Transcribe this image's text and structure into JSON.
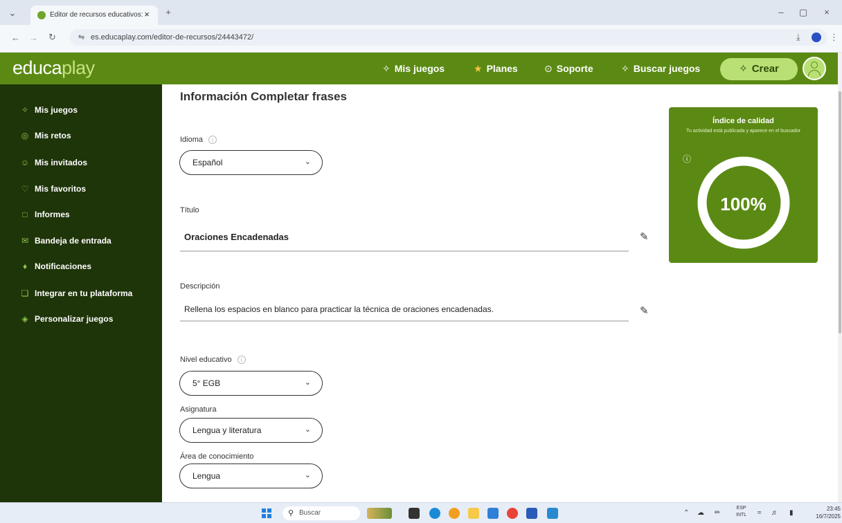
{
  "browser": {
    "tab_title": "Editor de recursos educativos: ·",
    "tab_close": "×",
    "new_tab": "+",
    "tab_menu": "⌄",
    "url": "es.educaplay.com/editor-de-recursos/24443472/",
    "window_controls": [
      "–",
      "▢",
      "×"
    ]
  },
  "header": {
    "logo_prefix": "educa",
    "logo_suffix": "play",
    "nav": [
      {
        "label": "Mis juegos",
        "icon": "puzzle-icon"
      },
      {
        "label": "Planes",
        "icon": "star-icon"
      },
      {
        "label": "Soporte",
        "icon": "support-icon"
      },
      {
        "label": "Buscar juegos",
        "icon": "search-puzzle-icon"
      }
    ],
    "create_label": "Crear"
  },
  "sidebar": {
    "items": [
      {
        "label": "Mis juegos",
        "icon": "puzzle-icon"
      },
      {
        "label": "Mis retos",
        "icon": "target-icon"
      },
      {
        "label": "Mis invitados",
        "icon": "users-icon"
      },
      {
        "label": "Mis favoritos",
        "icon": "heart-icon"
      },
      {
        "label": "Informes",
        "icon": "clipboard-icon"
      },
      {
        "label": "Bandeja de entrada",
        "icon": "mail-icon"
      },
      {
        "label": "Notificaciones",
        "icon": "bell-icon"
      },
      {
        "label": "Integrar en tu plataforma",
        "icon": "cube-icon"
      },
      {
        "label": "Personalizar juegos",
        "icon": "palette-icon"
      }
    ]
  },
  "form": {
    "title": "Información Completar frases",
    "language": {
      "label": "Idioma",
      "value": "Español"
    },
    "title_field": {
      "label": "Título",
      "value": "Oraciones Encadenadas"
    },
    "description": {
      "label": "Descripción",
      "value": "Rellena los espacios en blanco para practicar la técnica de oraciones encadenadas."
    },
    "level": {
      "label": "Nivel educativo",
      "value": "5° EGB"
    },
    "subject": {
      "label": "Asignatura",
      "value": "Lengua y literatura"
    },
    "area": {
      "label": "Área de conocimiento",
      "value": "Lengua"
    }
  },
  "quality": {
    "title": "Índice de calidad",
    "subtitle": "Tu actividad está publicada y aparece en el buscador",
    "percent_label": "100%",
    "percent": 100
  },
  "taskbar": {
    "search_placeholder": "Buscar",
    "lang_top": "ESP",
    "lang_bottom": "INTL",
    "time": "23:45",
    "date": "16/7/2025"
  },
  "colors": {
    "brand_green": "#5b8a14",
    "sidebar_bg": "#1e3409",
    "accent_light": "#b9e075"
  }
}
